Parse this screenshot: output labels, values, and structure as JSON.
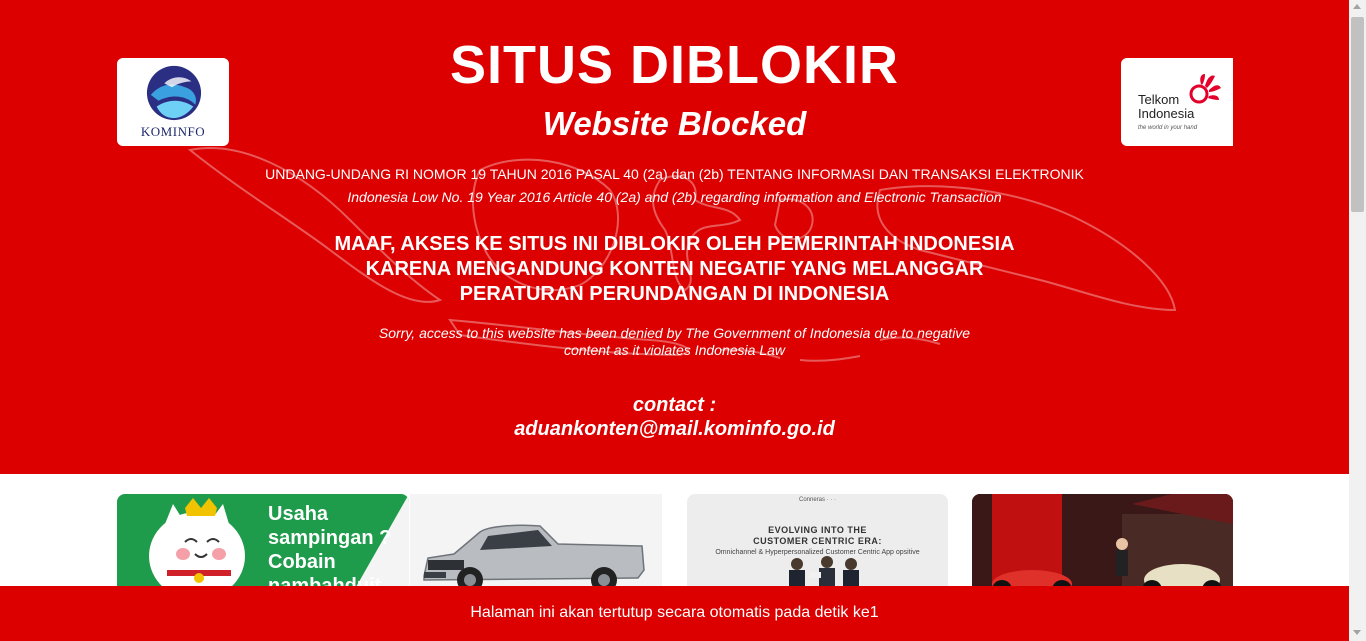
{
  "banner": {
    "background_color": "#dc0000",
    "title": "SITUS DIBLOKIR",
    "subtitle": "Website Blocked",
    "law_id": "UNDANG-UNDANG RI NOMOR 19 TAHUN 2016 PASAL 40 (2a) dan (2b) TENTANG INFORMASI DAN TRANSAKSI ELEKTRONIK",
    "law_en": "Indonesia Low No. 19 Year 2016 Article 40 (2a) and (2b) regarding information and Electronic Transaction",
    "notice_id": [
      "MAAF, AKSES KE SITUS INI DIBLOKIR OLEH PEMERINTAH INDONESIA",
      "KARENA MENGANDUNG KONTEN NEGATIF YANG MELANGGAR",
      "PERATURAN  PERUNDANGAN DI INDONESIA"
    ],
    "notice_en": [
      "Sorry, access to this website has been denied by The Government of Indonesia due to negative",
      "content as it violates Indonesia Law"
    ],
    "contact_label": "contact :",
    "contact_email": "aduankonten@mail.kominfo.go.id",
    "background_icon": "indonesia-map-outline"
  },
  "logos": {
    "left": {
      "text": "KOMINFO",
      "icon": "kominfo-logo"
    },
    "right": {
      "line1": "Telkom",
      "line2": "Indonesia",
      "tagline": "the world in your hand",
      "icon": "telkom-logo"
    }
  },
  "thumbnails": {
    "ad": {
      "lines": [
        "Usaha",
        "sampingan ?",
        "Cobain",
        "nambahduit"
      ],
      "color": "#1e9b4b",
      "icon": "lucky-cat"
    },
    "car": {
      "icon": "pickup-truck"
    },
    "event": {
      "brand": "Conneras  ·  ·  ·",
      "title_lines": [
        "EVOLVING INTO THE",
        "CUSTOMER CENTRIC ERA:"
      ],
      "subtitle": "Omnichannel & Hyperpersonalized Customer Centric App opsitive",
      "icon": "people-on-stage"
    },
    "expo": {
      "icon": "scooter-exhibition"
    }
  },
  "countdown": {
    "text": "Halaman ini akan tertutup secara otomatis pada detik ke1",
    "background_color": "#dc0000"
  }
}
